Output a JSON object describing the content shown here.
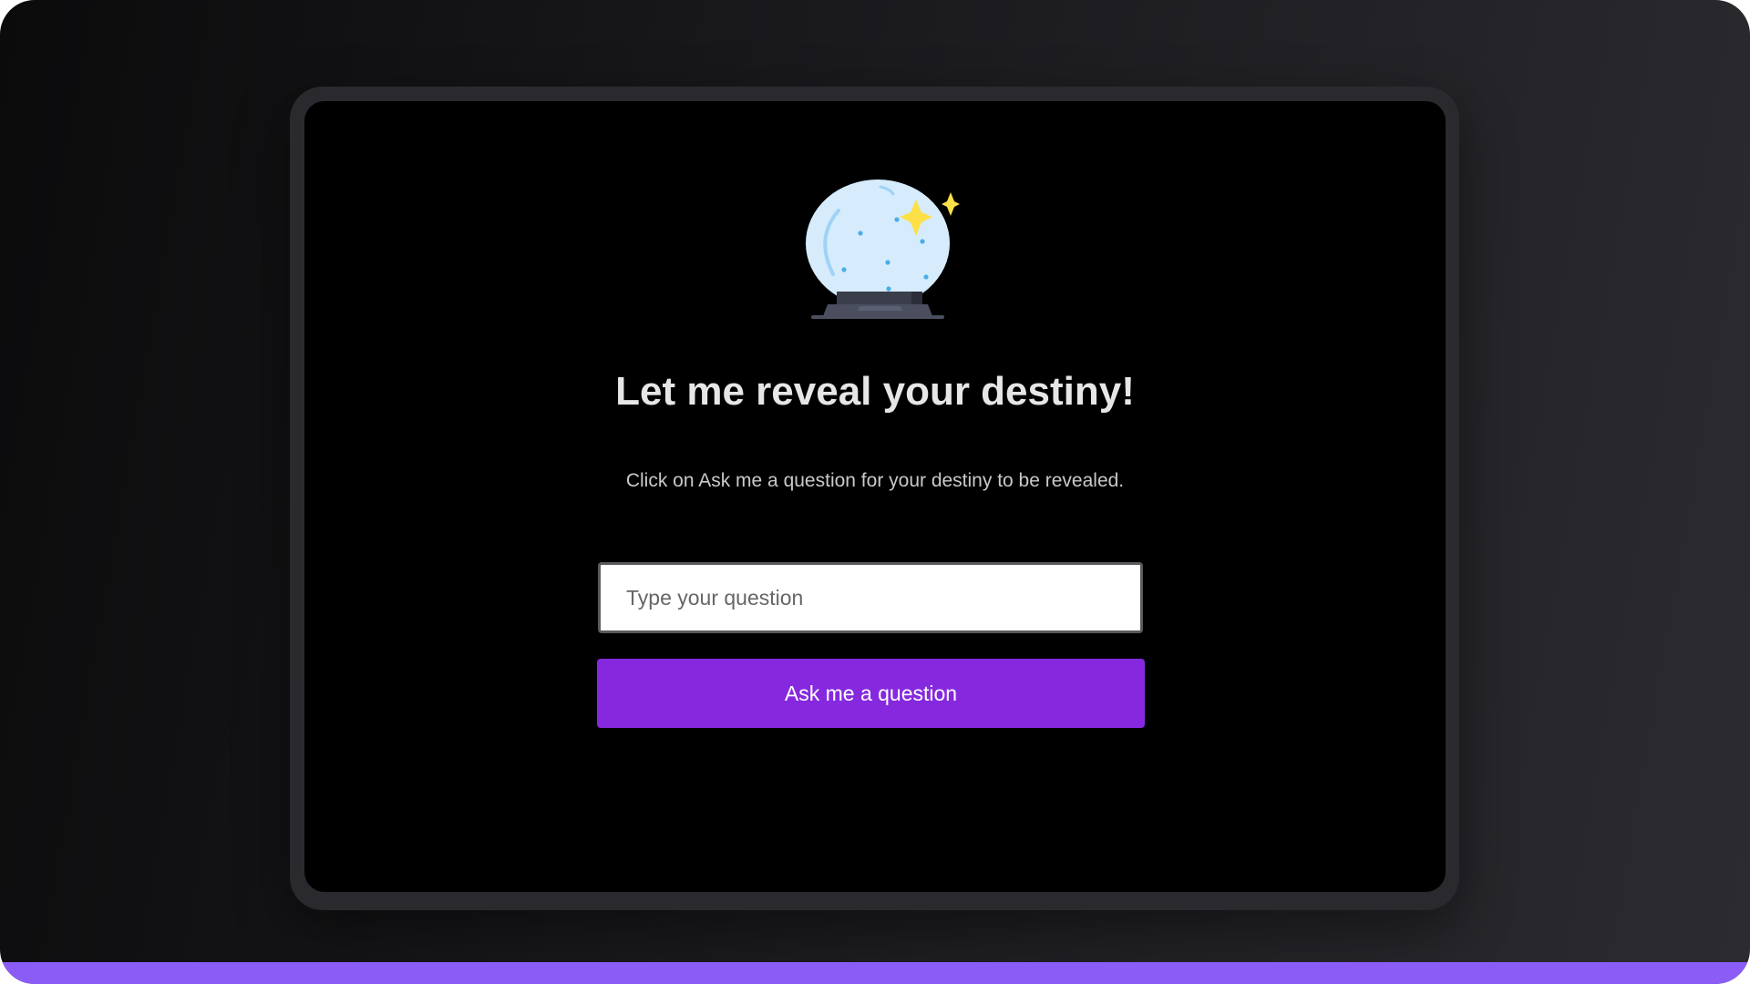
{
  "hero": {
    "icon": "crystal-ball-icon",
    "headline": "Let me reveal your destiny!",
    "subtitle": "Click on Ask me a question for your destiny to be revealed."
  },
  "form": {
    "question_placeholder": "Type your question",
    "question_value": "",
    "ask_button_label": "Ask me a question"
  },
  "colors": {
    "accent": "#8629de",
    "bottom_bar": "#8b5cf6",
    "screen_background": "#000000"
  }
}
